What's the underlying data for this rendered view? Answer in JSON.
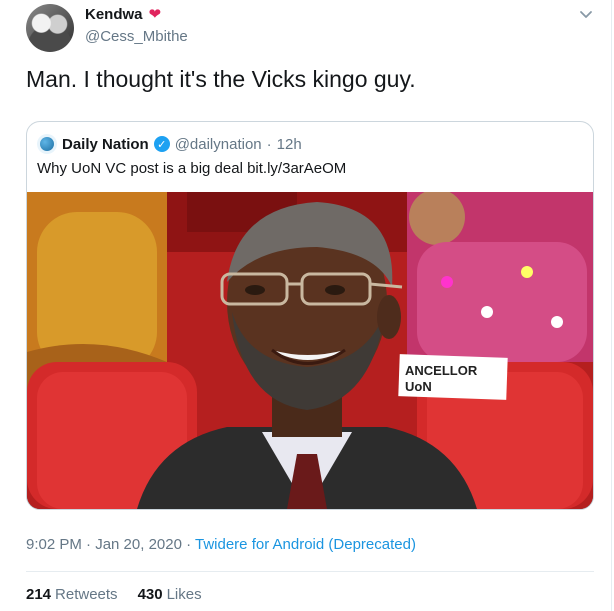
{
  "tweet": {
    "display_name": "Kendwa",
    "handle": "@Cess_Mbithe",
    "text": "Man. I thought it's the Vicks kingo guy.",
    "timestamp": "9:02 PM · Jan 20, 2020",
    "separator": " · ",
    "source": "Twidere for Android (Deprecated)",
    "retweets_count": "214",
    "retweets_label": "Retweets",
    "likes_count": "430",
    "likes_label": "Likes"
  },
  "quoted": {
    "display_name": "Daily Nation",
    "handle": "@dailynation",
    "dot": "·",
    "time": "12h",
    "text": "Why UoN VC post is a big deal bit.ly/3arAeOM"
  },
  "photo": {
    "placard_line1": "ANCELLOR",
    "placard_line2": "UoN"
  },
  "colors": {
    "link": "#1b95e0",
    "verified": "#1da1f2",
    "heart": "#e0245e",
    "muted": "#657786"
  },
  "icons": [
    "heart-icon",
    "chevron-down-icon",
    "daily-nation-logo-icon",
    "verified-badge-icon"
  ]
}
